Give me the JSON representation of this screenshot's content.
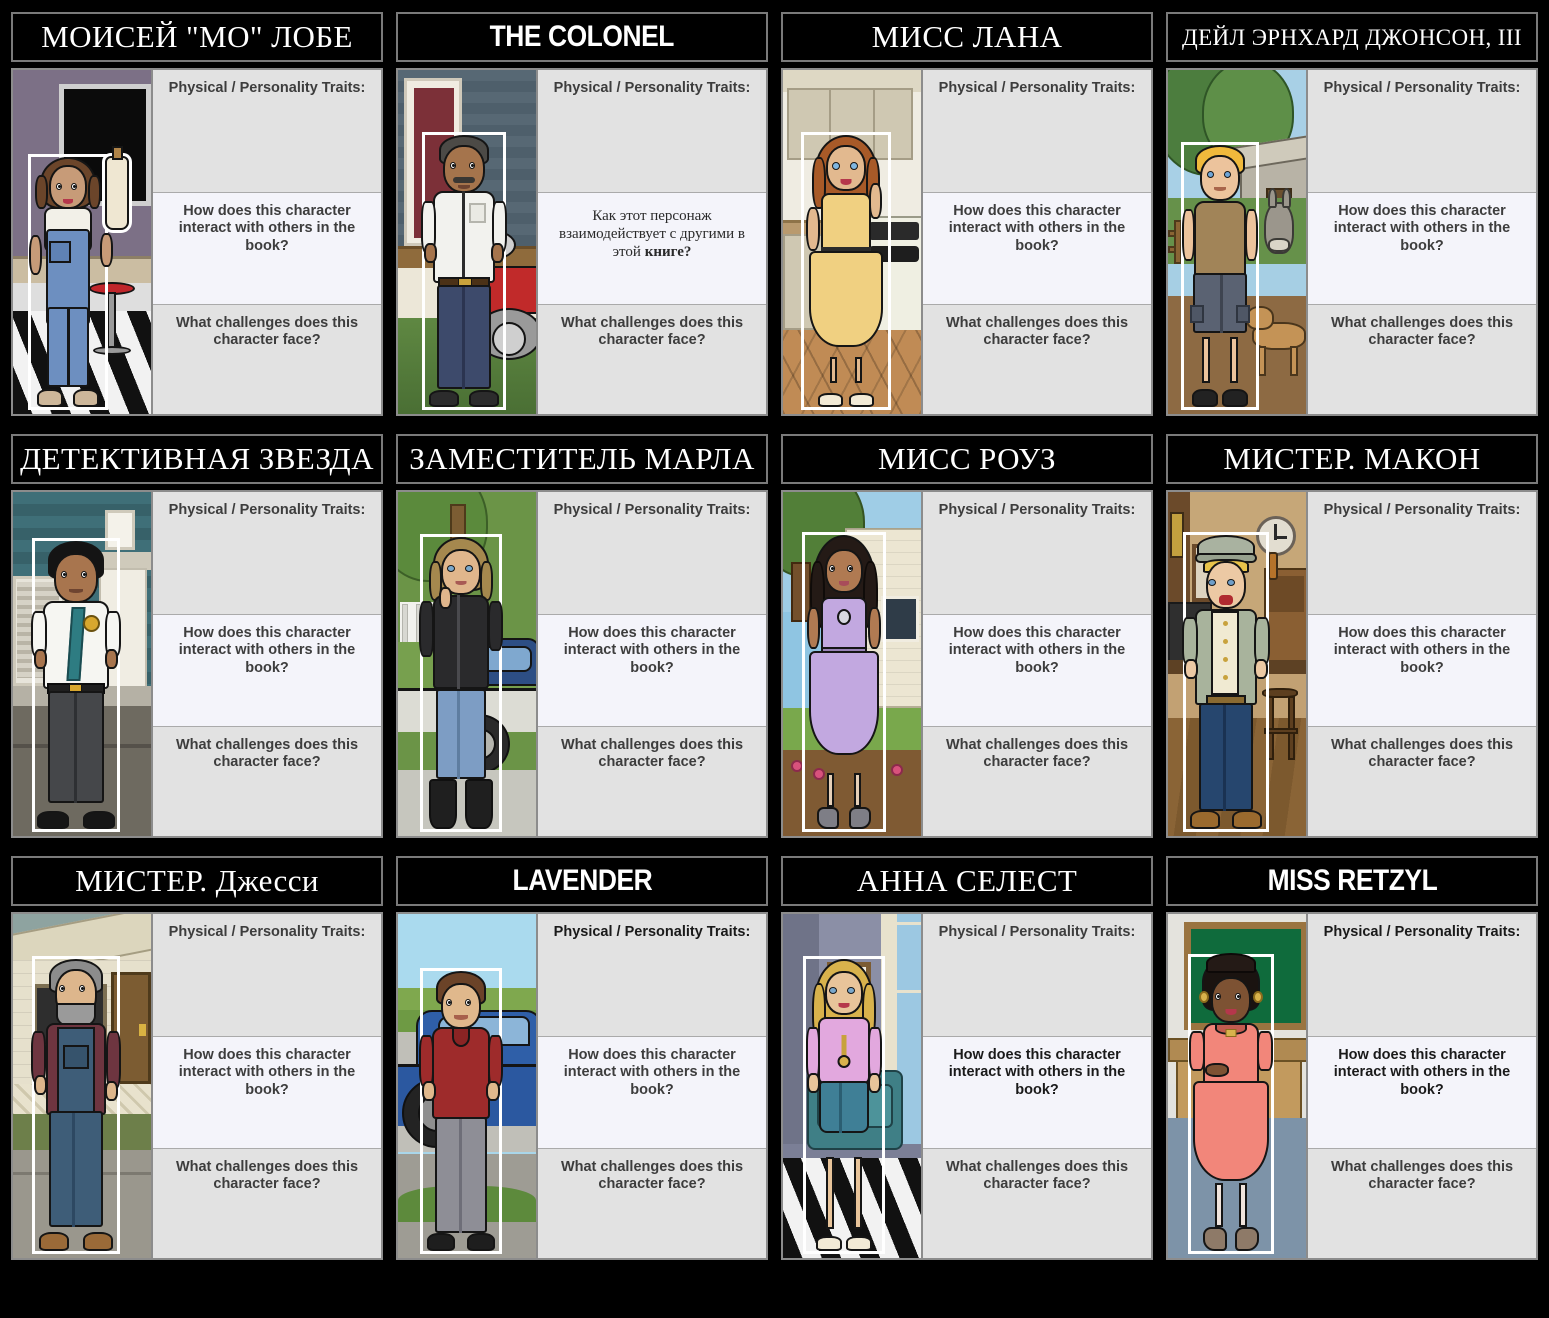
{
  "board": {
    "background_color": "#000000",
    "title_bar_background": "#000000",
    "title_bar_border": "#7a7a7a",
    "panel_shade_a": "#e2e2e2",
    "panel_shade_b": "#f4f4fa"
  },
  "prompts": {
    "traits_en": "Physical / Personality Traits:",
    "interact_en": "How does this character interact with others in the book?",
    "interact_ru_pre": "Как этот персонаж взаимодействует с другими в этой ",
    "interact_ru_bold": "книге?",
    "challenges_en": "What challenges does this character face?"
  },
  "rows": [
    {
      "cells": [
        {
          "title": "МОИСЕЙ \"МО\" ЛОБЕ",
          "title_style": "serif",
          "scene": "diner-interior",
          "q1": "Physical / Personality Traits:",
          "q2": "How does this character interact with others in the book?",
          "q2_lang": "en",
          "q3": "What challenges does this character face?"
        },
        {
          "title": "THE COLONEL",
          "title_style": "sans",
          "scene": "porch-car",
          "q1": "Physical / Personality Traits:",
          "q2": "Как этот персонаж взаимодействует с другими в этой книге?",
          "q2_lang": "ru",
          "q3": "What challenges does this character face?"
        },
        {
          "title": "МИСС ЛАНА",
          "title_style": "serif",
          "scene": "kitchen",
          "q1": "Physical / Personality Traits:",
          "q2": "How does this character interact with others in the book?",
          "q2_lang": "en",
          "q3": "What challenges does this character face?"
        },
        {
          "title": "ДЕЙЛ ЭРНХАРД ДЖОНСОН, III",
          "title_style": "serif-wrap",
          "scene": "farmyard",
          "q1": "Physical / Personality Traits:",
          "q2": "How does this character interact with others in the book?",
          "q2_lang": "en",
          "q3": "What challenges does this character face?"
        }
      ]
    },
    {
      "cells": [
        {
          "title": "ДЕТЕКТИВНАЯ ЗВЕЗДА",
          "title_style": "serif",
          "scene": "police-porch",
          "q1": "Physical / Personality Traits:",
          "q2": "How does this character interact with others in the book?",
          "q2_lang": "en",
          "q3": "What challenges does this character face?"
        },
        {
          "title": "ЗАМЕСТИТЕЛЬ МАРЛА",
          "title_style": "serif",
          "scene": "patrol-car",
          "q1": "Physical / Personality Traits:",
          "q2": "How does this character interact with others in the book?",
          "q2_lang": "en",
          "q3": "What challenges does this character face?"
        },
        {
          "title": "МИСС РОУЗ",
          "title_style": "serif",
          "scene": "garden-house",
          "q1": "Physical / Personality Traits:",
          "q2": "How does this character interact with others in the book?",
          "q2_lang": "en",
          "q3": "What challenges does this character face?"
        },
        {
          "title": "МИСТЕР. МАКОН",
          "title_style": "serif",
          "scene": "bar-interior",
          "q1": "Physical / Personality Traits:",
          "q2": "How does this character interact with others in the book?",
          "q2_lang": "en",
          "q3": "What challenges does this character face?"
        }
      ]
    },
    {
      "cells": [
        {
          "title": "МИСТЕР. Джесси",
          "title_style": "serif",
          "scene": "old-house",
          "q1": "Physical / Personality Traits:",
          "q2": "How does this character interact with others in the book?",
          "q2_lang": "en",
          "q3": "What challenges does this character face?"
        },
        {
          "title": "LAVENDER",
          "title_style": "sans",
          "scene": "race-car",
          "q1": "Physical / Personality Traits:",
          "q2": "How does this character interact with others in the book?",
          "q2_lang": "en",
          "q3": "What challenges does this character face?"
        },
        {
          "title": "АННА СЕЛЕСТ",
          "title_style": "serif",
          "scene": "living-room",
          "q1": "Physical / Personality Traits:",
          "q2": "How does this character interact with others in the book?",
          "q2_lang": "en",
          "q3": "What challenges does this character face?"
        },
        {
          "title": "MISS RETZYL",
          "title_style": "sans",
          "scene": "classroom",
          "q1": "Physical / Personality Traits:",
          "q2": "How does this character interact with others in the book?",
          "q2_lang": "en",
          "q3": "What challenges does this character face?"
        }
      ]
    }
  ]
}
